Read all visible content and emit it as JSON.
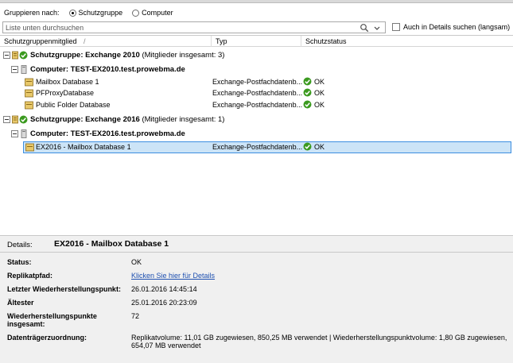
{
  "groupby": {
    "label": "Gruppieren nach:",
    "options": [
      "Schutzgruppe",
      "Computer"
    ],
    "selected": "Schutzgruppe"
  },
  "search": {
    "placeholder": "Liste unten durchsuchen",
    "details_checkbox_label": "Auch in Details suchen (langsam)"
  },
  "columns": {
    "member": "Schutzgruppenmitglied",
    "type": "Typ",
    "status": "Schutzstatus"
  },
  "groups": [
    {
      "label": "Schutzgruppe: Exchange 2010",
      "members": "(Mitglieder insgesamt: 3)",
      "computer": "Computer: TEST-EX2010.test.prowebma.de",
      "items": [
        {
          "name": "Mailbox Database 1",
          "type": "Exchange-Postfachdatenb...",
          "status": "OK"
        },
        {
          "name": "PFProxyDatabase",
          "type": "Exchange-Postfachdatenb...",
          "status": "OK"
        },
        {
          "name": "Public Folder Database",
          "type": "Exchange-Postfachdatenb...",
          "status": "OK"
        }
      ]
    },
    {
      "label": "Schutzgruppe: Exchange 2016",
      "members": "(Mitglieder insgesamt: 1)",
      "computer": "Computer: TEST-EX2016.test.prowebma.de",
      "items": [
        {
          "name": "EX2016 - Mailbox Database 1",
          "type": "Exchange-Postfachdatenb...",
          "status": "OK"
        }
      ]
    }
  ],
  "details": {
    "label": "Details:",
    "title": "EX2016 - Mailbox Database 1",
    "rows": [
      {
        "label": "Status:",
        "value": "OK"
      },
      {
        "label": "Replikatpfad:",
        "value": "Klicken Sie hier für Details"
      },
      {
        "label": "Letzter Wiederherstellungspunkt:",
        "value": "26.01.2016 14:45:14"
      },
      {
        "label": "Ältester",
        "value": "25.01.2016 20:23:09"
      },
      {
        "label": "Wiederherstellungspunkte",
        "label2": "insgesamt:",
        "value": "72"
      },
      {
        "label": "Datenträgerzuordnung:",
        "value": "Replikatvolume: 11,01 GB zugewiesen, 850,25 MB verwendet | Wiederherstellungspunktvolume: 1,80 GB zugewiesen,",
        "value2": "654,07 MB verwendet"
      }
    ]
  },
  "colors": {
    "ok_green": "#3b9a1f",
    "selection": "#cce4f7",
    "selection_border": "#3d8ee0",
    "link": "#1d4fb0"
  },
  "icons": [
    "group-icon",
    "ok-check-icon",
    "computer-icon",
    "database-icon",
    "search-icon",
    "dropdown-icon"
  ]
}
